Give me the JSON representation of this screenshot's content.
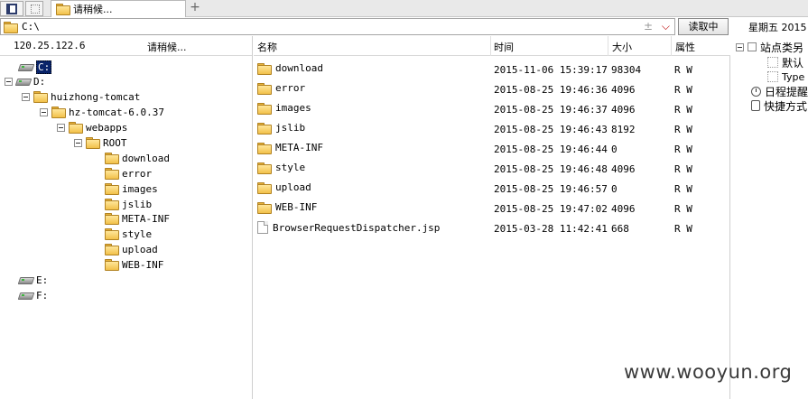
{
  "tab": {
    "title": "请稍候..."
  },
  "address": {
    "path": "C:\\",
    "plusminus": "±",
    "read_button": "读取中"
  },
  "day_label": "星期五 2015",
  "left_pane": {
    "ip": "120.25.122.6",
    "status": "请稍候..."
  },
  "tree": [
    {
      "label": "C:",
      "type": "drive",
      "selected": true
    },
    {
      "label": "D:",
      "type": "drive"
    },
    {
      "label": "huizhong-tomcat",
      "type": "folder"
    },
    {
      "label": "hz-tomcat-6.0.37",
      "type": "folder"
    },
    {
      "label": "webapps",
      "type": "folder"
    },
    {
      "label": "ROOT",
      "type": "folder"
    },
    {
      "label": "download",
      "type": "folder"
    },
    {
      "label": "error",
      "type": "folder"
    },
    {
      "label": "images",
      "type": "folder"
    },
    {
      "label": "jslib",
      "type": "folder"
    },
    {
      "label": "META-INF",
      "type": "folder"
    },
    {
      "label": "style",
      "type": "folder"
    },
    {
      "label": "upload",
      "type": "folder"
    },
    {
      "label": "WEB-INF",
      "type": "folder"
    },
    {
      "label": "E:",
      "type": "drive"
    },
    {
      "label": "F:",
      "type": "drive"
    }
  ],
  "columns": {
    "name": "名称",
    "time": "时间",
    "size": "大小",
    "attr": "属性"
  },
  "files": [
    {
      "name": "download",
      "type": "folder",
      "time": "2015-11-06 15:39:17",
      "size": "98304",
      "attr": "R W"
    },
    {
      "name": "error",
      "type": "folder",
      "time": "2015-08-25 19:46:36",
      "size": "4096",
      "attr": "R W"
    },
    {
      "name": "images",
      "type": "folder",
      "time": "2015-08-25 19:46:37",
      "size": "4096",
      "attr": "R W"
    },
    {
      "name": "jslib",
      "type": "folder",
      "time": "2015-08-25 19:46:43",
      "size": "8192",
      "attr": "R W"
    },
    {
      "name": "META-INF",
      "type": "folder",
      "time": "2015-08-25 19:46:44",
      "size": "0",
      "attr": "R W"
    },
    {
      "name": "style",
      "type": "folder",
      "time": "2015-08-25 19:46:48",
      "size": "4096",
      "attr": "R W"
    },
    {
      "name": "upload",
      "type": "folder",
      "time": "2015-08-25 19:46:57",
      "size": "0",
      "attr": "R W"
    },
    {
      "name": "WEB-INF",
      "type": "folder",
      "time": "2015-08-25 19:47:02",
      "size": "4096",
      "attr": "R W"
    },
    {
      "name": "BrowserRequestDispatcher.jsp",
      "type": "file",
      "time": "2015-03-28 11:42:41",
      "size": "668",
      "attr": "R W"
    }
  ],
  "right_pane": {
    "site_category": "站点类另",
    "default": "默认",
    "type": "Type",
    "schedule": "日程提醒",
    "shortcut": "快捷方式"
  },
  "watermark": "www.wooyun.org"
}
